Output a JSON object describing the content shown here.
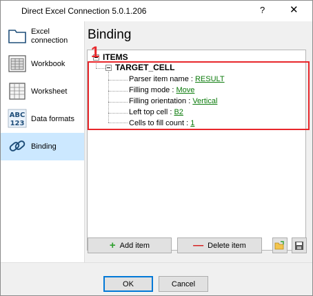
{
  "window": {
    "title": "Direct Excel Connection 5.0.1.206",
    "help": "?",
    "close": "✕"
  },
  "sidebar": {
    "items": [
      {
        "label": "Excel\nconnection",
        "icon": "folder-icon"
      },
      {
        "label": "Workbook",
        "icon": "workbook-icon"
      },
      {
        "label": "Worksheet",
        "icon": "worksheet-icon"
      },
      {
        "label": "Data formats",
        "icon": "abc-123-icon"
      },
      {
        "label": "Binding",
        "icon": "chain-link-icon"
      }
    ],
    "active_index": 4
  },
  "main": {
    "heading": "Binding",
    "tree": {
      "root": "ITEMS",
      "child": "TARGET_CELL",
      "props": [
        {
          "label": "Parser item name : ",
          "value": "RESULT"
        },
        {
          "label": "Filling mode : ",
          "value": "Move"
        },
        {
          "label": "Filling orientation : ",
          "value": "Vertical"
        },
        {
          "label": "Left top cell : ",
          "value": "B2"
        },
        {
          "label": "Cells to fill count : ",
          "value": "1"
        }
      ]
    },
    "annotation": {
      "number": "1",
      "color": "#e8262a"
    },
    "buttons": {
      "add_item": "Add item",
      "delete_item": "Delete item"
    }
  },
  "footer": {
    "ok": "OK",
    "cancel": "Cancel"
  },
  "colors": {
    "active_nav": "#cce8ff",
    "link": "#0a7a0a",
    "add": "#2ea02e",
    "delete": "#d62020"
  }
}
